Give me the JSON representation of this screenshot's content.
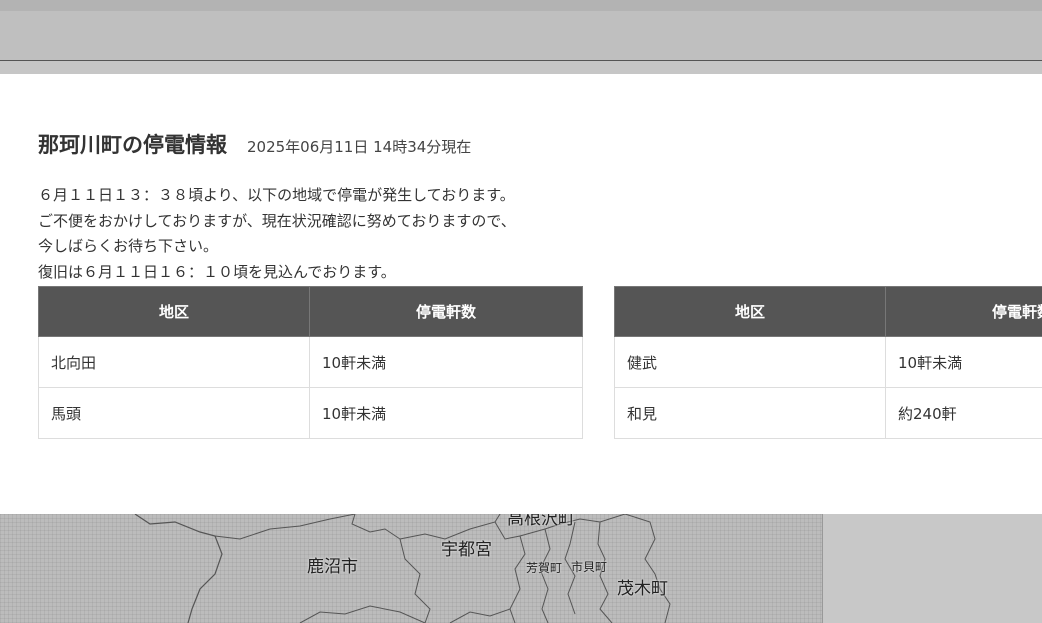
{
  "header": {
    "title": "那珂川町の停電情報",
    "timestamp": "2025年06月11日 14時34分現在"
  },
  "message": {
    "lines": [
      "６月１１日１３：３８頃より、以下の地域で停電が発生しております。",
      "ご不便をおかけしておりますが、現在状況確認に努めておりますので、",
      "今しばらくお待ち下さい。",
      "復旧は６月１１日１６：１０頃を見込んでおります。"
    ]
  },
  "tables": {
    "left": {
      "headers": [
        "地区",
        "停電軒数"
      ],
      "rows": [
        [
          "北向田",
          "10軒未満"
        ],
        [
          "馬頭",
          "10軒未満"
        ]
      ]
    },
    "right": {
      "headers": [
        "地区",
        "停電軒数"
      ],
      "rows": [
        [
          "健武",
          "10軒未満"
        ],
        [
          "和見",
          "約240軒"
        ]
      ]
    }
  },
  "map": {
    "labels": [
      "鹿沼市",
      "宇都宮",
      "高根沢町",
      "芳賀町",
      "市貝町",
      "茂木町"
    ]
  }
}
